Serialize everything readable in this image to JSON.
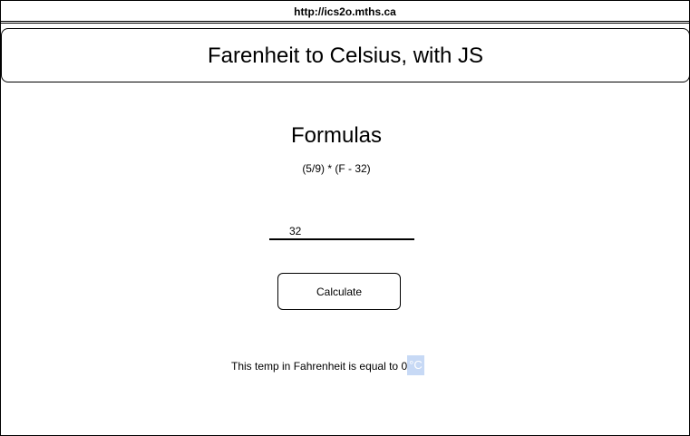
{
  "browser": {
    "url": "http://ics2o.mths.ca"
  },
  "header": {
    "title": "Farenheit to Celsius, with JS"
  },
  "formulas": {
    "title": "Formulas",
    "formula": "(5/9) * (F - 32)"
  },
  "input": {
    "value": "32"
  },
  "button": {
    "label": "Calculate"
  },
  "result": {
    "prefix": "This temp in Fahrenheit is equal to",
    "value": "0",
    "unit": "°C"
  },
  "colors": {
    "highlight": "#c7d9f5"
  }
}
